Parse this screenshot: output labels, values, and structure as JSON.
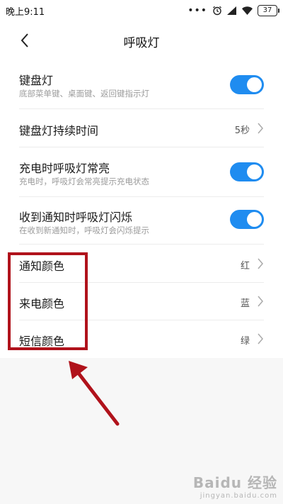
{
  "status_bar": {
    "time": "晚上9:11",
    "battery": "37",
    "icons": [
      "more-dots-icon",
      "alarm-icon",
      "signal-icon",
      "wifi-icon",
      "battery-icon"
    ]
  },
  "header": {
    "title": "呼吸灯",
    "back_icon": "chevron-left-icon"
  },
  "settings": {
    "keyboard_light": {
      "title": "键盘灯",
      "subtitle": "底部菜单键、桌面键、返回键指示灯",
      "enabled": true
    },
    "keyboard_duration": {
      "title": "键盘灯持续时间",
      "value": "5秒"
    },
    "charging_light": {
      "title": "充电时呼吸灯常亮",
      "subtitle": "充电时，呼吸灯会常亮提示充电状态",
      "enabled": true
    },
    "notification_blink": {
      "title": "收到通知时呼吸灯闪烁",
      "subtitle": "在收到新通知时，呼吸灯会闪烁提示",
      "enabled": true
    },
    "notification_color": {
      "title": "通知颜色",
      "value": "红"
    },
    "call_color": {
      "title": "来电颜色",
      "value": "蓝"
    },
    "sms_color": {
      "title": "短信颜色",
      "value": "绿"
    }
  },
  "colors": {
    "toggle_on": "#1f8cf0",
    "annotation": "#b0121b"
  },
  "watermark": {
    "main": "Baidu 经验",
    "sub": "jingyan.baidu.com"
  }
}
